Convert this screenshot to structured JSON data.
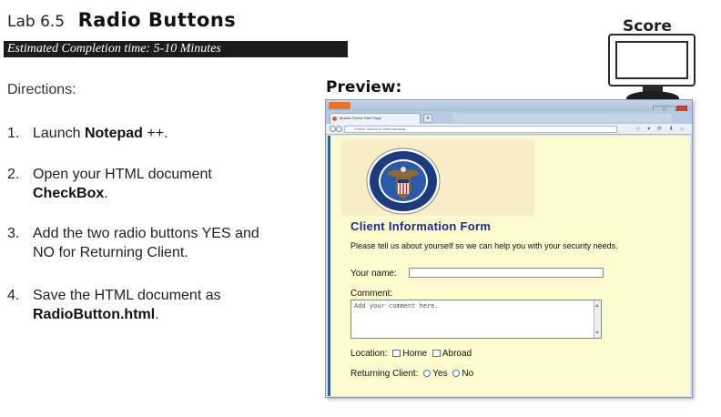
{
  "lab": {
    "number": "Lab 6.5",
    "title": "Radio Buttons",
    "time": "Estimated Completion time: 5-10 Minutes"
  },
  "directions_label": "Directions:",
  "steps": [
    {
      "num": "1.",
      "pre": "Launch ",
      "bold": "Notepad",
      "post": " ++."
    },
    {
      "num": "2.",
      "pre": "Open your HTML document ",
      "bold": "CheckBox",
      "post": "."
    },
    {
      "num": "3.",
      "pre": "Add the two radio buttons YES and NO for Returning Client.",
      "bold": "",
      "post": ""
    },
    {
      "num": "4.",
      "pre": "Save the HTML document as ",
      "bold": "RadioButton.html",
      "post": "."
    }
  ],
  "score_label": "Score",
  "preview_label": "Preview:",
  "browser": {
    "tab_title": "Mozilla Firefox Start Page",
    "new_tab": "+",
    "url_placeholder": "Firefox  Search or enter address",
    "tool_icons": "☆ ▾ ⟳ ⬇ ⌂",
    "page": {
      "form_title": "Client Information Form",
      "description": "Please tell us about yourself so we can help you with your security needs.",
      "name_label": "Your name:",
      "comment_label": "Comment:",
      "comment_placeholder": "Add your comment here.",
      "location_label": "Location:",
      "location_options": [
        "Home",
        "Abroad"
      ],
      "returning_label": "Returning Client:",
      "returning_options": [
        "Yes",
        "No"
      ]
    }
  },
  "colors": {
    "form_title": "#1c2a86",
    "page_background": "#fcfbd0",
    "time_bar": "#1c1c1c"
  }
}
